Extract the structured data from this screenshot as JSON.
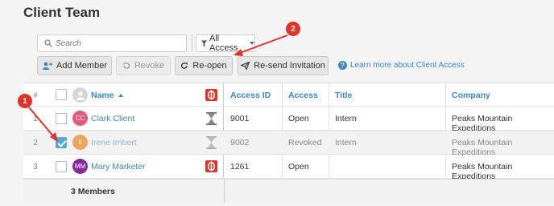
{
  "page": {
    "title": "Client Team"
  },
  "search": {
    "placeholder": "Search"
  },
  "filter": {
    "label": "All Access"
  },
  "toolbar": {
    "add_member": "Add Member",
    "revoke": "Revoke",
    "reopen": "Re-open",
    "resend": "Re-send Invitation",
    "help_link": "Learn more about Client Access"
  },
  "table": {
    "headers": {
      "num": "#",
      "name": "Name",
      "access_id": "Access ID",
      "access": "Access",
      "title": "Title",
      "company": "Company"
    },
    "rows": [
      {
        "num": "1",
        "initials": "CC",
        "avatar_color": "#e35a7a",
        "name": "Clark Client",
        "access_id": "9001",
        "access": "Open",
        "title": "Intern",
        "company": "Peaks Mountain Expeditions",
        "checked": false,
        "status": "hourglass"
      },
      {
        "num": "2",
        "initials": "II",
        "avatar_color": "#f0a65a",
        "name": "Irene Imbert",
        "access_id": "9002",
        "access": "Revoked",
        "title": "Intern",
        "company": "Peaks Mountain Expeditions",
        "checked": true,
        "status": "hourglass"
      },
      {
        "num": "3",
        "initials": "MM",
        "avatar_color": "#8a2a9e",
        "name": "Mary Marketer",
        "access_id": "1261",
        "access": "Open",
        "title": "",
        "company": "Peaks Mountain Expeditions",
        "checked": false,
        "status": "open-badge"
      }
    ],
    "footer": "3 Members"
  },
  "annotations": {
    "one": "1",
    "two": "2"
  },
  "colors": {
    "accent": "#3a88c8",
    "annotation": "#e0342a",
    "selected_row": "#f2f2f2"
  }
}
